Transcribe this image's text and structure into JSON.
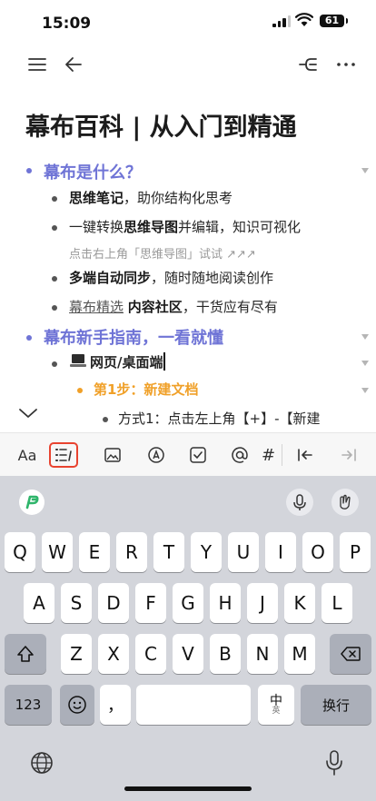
{
  "status_bar": {
    "time": "15:09",
    "battery": "61"
  },
  "document": {
    "title": "幕布百科 | 从入门到精通",
    "sections": [
      {
        "heading": "幕布是什么？",
        "items": [
          {
            "bold": "思维笔记",
            "rest": "，助你结构化思考"
          },
          {
            "pre": "一键转换",
            "bold": "思维导图",
            "rest": "并编辑，知识可视化",
            "note": "点击右上角「思维导图」试试 ↗↗↗"
          },
          {
            "bold": "多端自动同步",
            "rest": "，随时随地阅读创作"
          },
          {
            "link": "幕布精选",
            "bold": "内容社区",
            "rest": "，干货应有尽有"
          }
        ]
      },
      {
        "heading": "幕布新手指南，一看就懂",
        "sub_item": "网页/桌面端",
        "step": "第1步：新建文档",
        "step_item": "方式1：点击左上角【+】-【新建"
      }
    ]
  },
  "editor_toolbar": {
    "font_label": "Aa",
    "items": [
      "font-style",
      "list-format",
      "image",
      "draw",
      "checkbox",
      "mention",
      "tag",
      "outdent",
      "indent"
    ]
  },
  "keyboard": {
    "row1": [
      "Q",
      "W",
      "E",
      "R",
      "T",
      "Y",
      "U",
      "I",
      "O",
      "P"
    ],
    "row2": [
      "A",
      "S",
      "D",
      "F",
      "G",
      "H",
      "J",
      "K",
      "L"
    ],
    "row3": [
      "Z",
      "X",
      "C",
      "V",
      "B",
      "N",
      "M"
    ],
    "num_label": "123",
    "punct_label": "，",
    "lang_label": "中",
    "lang_sub": "英",
    "return_label": "换行"
  },
  "colors": {
    "heading": "#6f74d6",
    "step": "#f0a028",
    "highlight": "#e8432f"
  }
}
